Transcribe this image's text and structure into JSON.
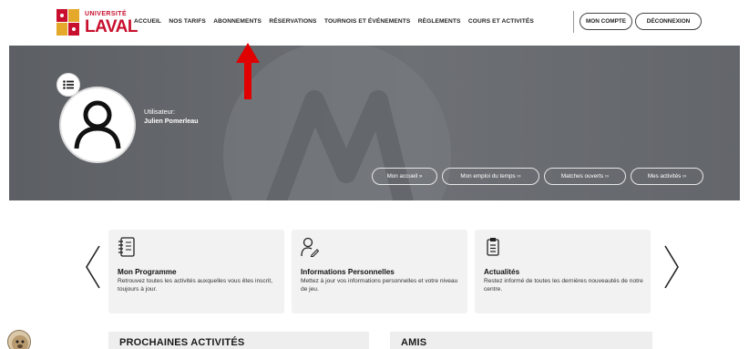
{
  "header": {
    "logo_top": "UNIVERSITÉ",
    "logo_main": "LAVAL",
    "nav": [
      {
        "label": "ACCUEIL"
      },
      {
        "label": "NOS TARIFS"
      },
      {
        "label": "ABONNEMENTS"
      },
      {
        "label": "RÉSERVATIONS"
      },
      {
        "label": "TOURNOIS ET ÉVÉNEMENTS"
      },
      {
        "label": "RÈGLEMENTS"
      },
      {
        "label": "COURS ET ACTIVITÉS"
      }
    ],
    "account_label": "MON COMPTE",
    "logout_label": "DÉCONNEXION"
  },
  "profile": {
    "user_label": "Utilisateur:",
    "user_name": "Julien Pomerleau"
  },
  "banner_links": [
    {
      "label": "Mon accueil »"
    },
    {
      "label": "Mon emploi du temps ››"
    },
    {
      "label": "Matches ouverts ››"
    },
    {
      "label": "Mes activités ››"
    }
  ],
  "cards": [
    {
      "title": "Mon Programme",
      "desc": "Retrouvez toutes les activités auxquelles vous êtes inscrit, toujours à jour.",
      "icon": "notebook-icon"
    },
    {
      "title": "Informations Personnelles",
      "desc": "Mettez à jour vos informations personnelles et votre niveau de jeu.",
      "icon": "user-edit-icon"
    },
    {
      "title": "Actualités",
      "desc": "Restez informé de toutes les dernières nouveautés de notre centre.",
      "icon": "news-icon"
    }
  ],
  "sections": {
    "upcoming": "PROCHAINES ACTIVITÉS",
    "friends": "AMIS"
  },
  "colors": {
    "brand_red": "#c8102e",
    "brand_gold": "#e4a92b",
    "banner_gray": "#676a6f",
    "arrow_red": "#e00000",
    "card_bg": "#f2f2f2"
  }
}
